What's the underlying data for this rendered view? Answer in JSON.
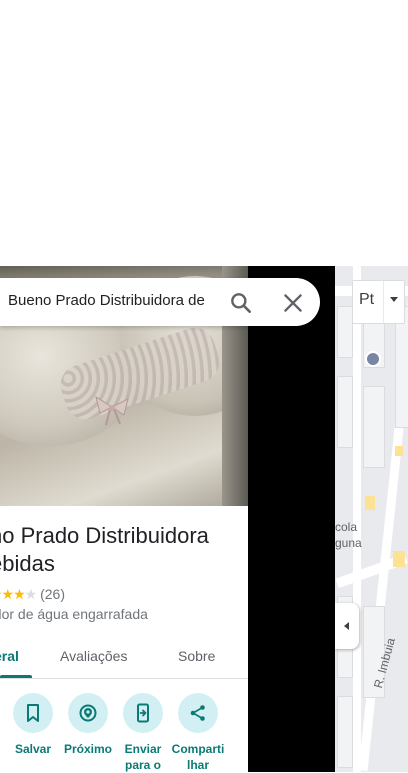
{
  "search": {
    "value": "Bueno Prado Distribuidora de"
  },
  "layer_control": {
    "label": "Pt"
  },
  "place": {
    "title": "no Prado Distribuidora ebidas",
    "title_line1": "no Prado Distribuidora",
    "title_line2": "ebidas",
    "rating_count": "(26)",
    "stars_filled": 3,
    "stars_total": 4,
    "category": "edor de água engarrafada"
  },
  "tabs": [
    {
      "label": "eral",
      "active": true
    },
    {
      "label": "Avaliações",
      "active": false
    },
    {
      "label": "Sobre",
      "active": false
    }
  ],
  "actions": [
    {
      "label": "Salvar",
      "icon": "bookmark-icon"
    },
    {
      "label": "Próximo",
      "icon": "nearby-icon"
    },
    {
      "label": "Enviar para o",
      "icon": "send-to-phone-icon"
    },
    {
      "label": "Compartilhar",
      "label_display": "Comparti lhar",
      "icon": "share-icon"
    }
  ],
  "map": {
    "labels": [
      "cola",
      "guna",
      "R. Imbuia"
    ]
  },
  "colors": {
    "accent": "#0b7a75",
    "action_bg": "#d2f0f4",
    "star": "#fbbc04",
    "map_bg": "#e8eaed"
  }
}
